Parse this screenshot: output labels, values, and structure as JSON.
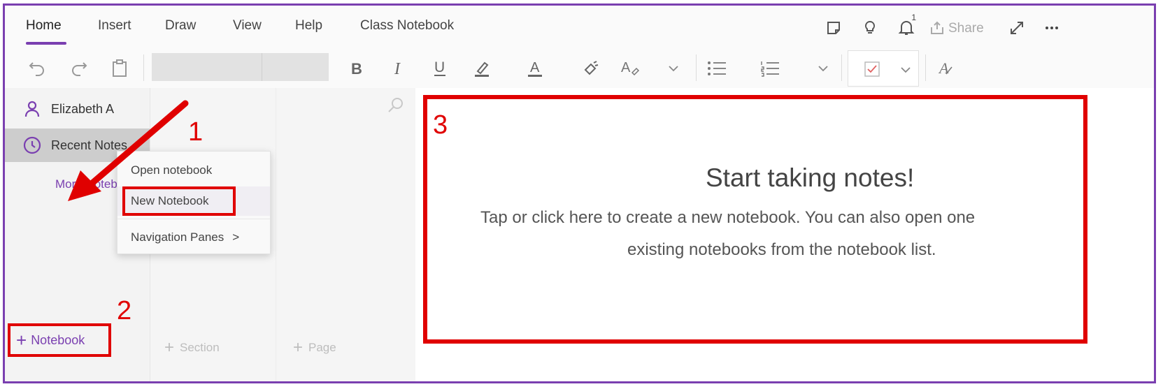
{
  "tabs": [
    {
      "label": "Home",
      "active": true
    },
    {
      "label": "Insert"
    },
    {
      "label": "Draw"
    },
    {
      "label": "View"
    },
    {
      "label": "Help"
    },
    {
      "label": "Class Notebook"
    }
  ],
  "top_icons": {
    "notification_count": "1",
    "share_label": "Share"
  },
  "ribbon": {
    "icons": [
      "undo-icon",
      "redo-icon",
      "clipboard-icon",
      "bold-icon",
      "italic-icon",
      "underline-icon",
      "highlighter-icon",
      "font-color-icon",
      "format-painter-icon",
      "clear-format-icon",
      "bullet-list-icon",
      "numbered-list-icon",
      "checkbox-tag-icon",
      "styles-icon"
    ]
  },
  "notebooks": {
    "items": [
      {
        "label": "Elizabeth A",
        "icon": "person-icon"
      },
      {
        "label": "Recent Notes",
        "icon": "clock-icon",
        "selected": true
      }
    ],
    "more_link": "More Notebooks",
    "add_label": "Notebook"
  },
  "context_menu": {
    "items": [
      "Open notebook",
      "New Notebook",
      "Navigation Panes"
    ],
    "submenu_glyph": ">"
  },
  "sections": {
    "add_section_label": "Section",
    "add_page_label": "Page"
  },
  "canvas": {
    "title": "Start taking notes!",
    "line1": "Tap or click here to create a new notebook. You can also open one",
    "line2": "existing notebooks from the notebook list."
  },
  "annotations": {
    "step1": "1",
    "step2": "2",
    "step3": "3"
  },
  "colors": {
    "accent": "#7a3fb0",
    "annotation_red": "#e00000"
  }
}
